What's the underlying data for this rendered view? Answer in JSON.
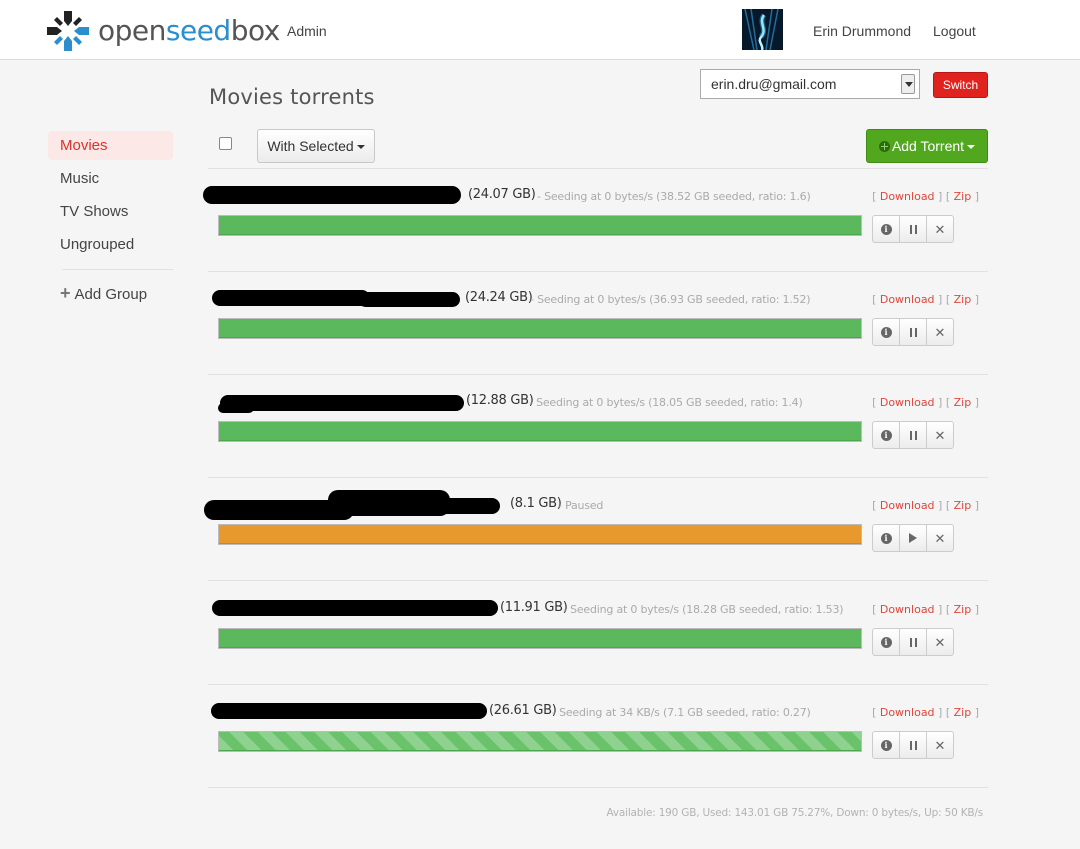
{
  "header": {
    "brand_part1": "open",
    "brand_part2": "seed",
    "brand_part3": "box",
    "admin_link": "Admin",
    "user_name": "Erin Drummond",
    "logout_link": "Logout"
  },
  "sidebar": {
    "items": [
      {
        "label": "Movies",
        "active": true
      },
      {
        "label": "Music",
        "active": false
      },
      {
        "label": "TV Shows",
        "active": false
      },
      {
        "label": "Ungrouped",
        "active": false
      }
    ],
    "add_group": "Add Group"
  },
  "main": {
    "title": "Movies torrents",
    "account_value": "erin.dru@gmail.com",
    "switch_label": "Switch",
    "with_selected_label": "With Selected",
    "add_torrent_label": "Add Torrent"
  },
  "torrents": [
    {
      "size": "(24.07 GB)",
      "status": "- Seeding at 0 bytes/s (38.52 GB seeded, ratio: 1.6)",
      "download": "Download",
      "zip": "Zip",
      "state": "seeding",
      "progress": 1.0
    },
    {
      "size": "(24.24 GB)",
      "status": "- Seeding at 0 bytes/s (36.93 GB seeded, ratio: 1.52)",
      "download": "Download",
      "zip": "Zip",
      "state": "seeding",
      "progress": 1.0
    },
    {
      "size": "(12.88 GB)",
      "status": "- Seeding at 0 bytes/s (18.05 GB seeded, ratio: 1.4)",
      "download": "Download",
      "zip": "Zip",
      "state": "seeding",
      "progress": 1.0
    },
    {
      "size": "(8.1 GB)",
      "status": "- Paused",
      "download": "Download",
      "zip": "Zip",
      "state": "paused",
      "progress": 1.0
    },
    {
      "size": "(11.91 GB)",
      "status": "- Seeding at 0 bytes/s (18.28 GB seeded, ratio: 1.53)",
      "download": "Download",
      "zip": "Zip",
      "state": "seeding",
      "progress": 1.0
    },
    {
      "size": "(26.61 GB)",
      "status": "- Seeding at 34 KB/s (7.1 GB seeded, ratio: 0.27)",
      "download": "Download",
      "zip": "Zip",
      "state": "active",
      "progress": 1.0
    }
  ],
  "footer": {
    "stats": "Available: 190 GB, Used: 143.01 GB 75.27%, Down: 0 bytes/s, Up: 50 KB/s"
  },
  "icons": {
    "logo": "openseedbox-logo",
    "info": "info-icon",
    "pause": "pause-icon",
    "play": "play-icon",
    "remove": "close-icon"
  },
  "colors": {
    "accent_red": "#d9332b",
    "switch_red": "#e0231f",
    "add_green": "#51a81f",
    "progress_green": "#5cb85c",
    "progress_orange": "#e8992e",
    "brand_blue": "#2a8fcf"
  }
}
